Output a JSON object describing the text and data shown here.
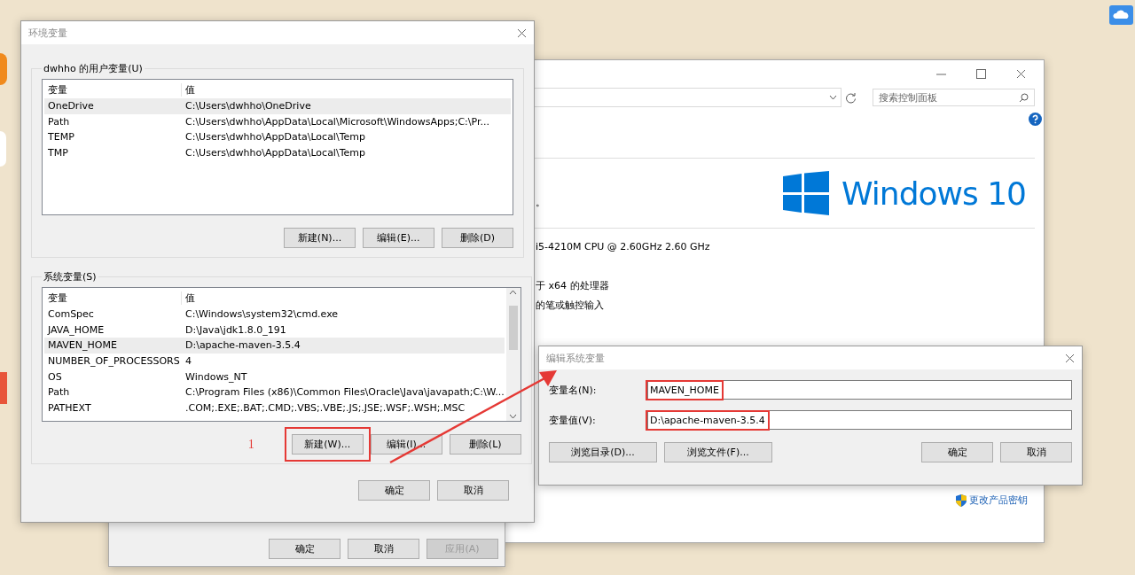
{
  "control_panel": {
    "search": {
      "placeholder": "搜索控制面板"
    },
    "texts": [
      "。",
      "i5-4210M CPU @ 2.60GHz   2.60 GHz",
      "于 x64 的处理器",
      "的笔或触控输入"
    ],
    "logo_text": "Windows 10",
    "link": "更改产品密钥"
  },
  "system_properties": {
    "buttons": [
      {
        "label": "确定",
        "disabled": false
      },
      {
        "label": "取消",
        "disabled": false
      },
      {
        "label": "应用(A)",
        "disabled": true
      }
    ]
  },
  "env_dialog": {
    "title": "环境变量",
    "groups": [
      {
        "label": "dwhho 的用户变量(U)",
        "columns": [
          "变量",
          "值"
        ],
        "scrollbar": false,
        "rows": [
          {
            "name": "OneDrive",
            "value": "C:\\Users\\dwhho\\OneDrive",
            "selected": true
          },
          {
            "name": "Path",
            "value": "C:\\Users\\dwhho\\AppData\\Local\\Microsoft\\WindowsApps;C:\\Pr...",
            "selected": false
          },
          {
            "name": "TEMP",
            "value": "C:\\Users\\dwhho\\AppData\\Local\\Temp",
            "selected": false
          },
          {
            "name": "TMP",
            "value": "C:\\Users\\dwhho\\AppData\\Local\\Temp",
            "selected": false
          }
        ],
        "buttons": [
          {
            "label": "新建(N)...",
            "highlighted": false
          },
          {
            "label": "编辑(E)...",
            "highlighted": false
          },
          {
            "label": "删除(D)",
            "highlighted": false
          }
        ]
      },
      {
        "label": "系统变量(S)",
        "columns": [
          "变量",
          "值"
        ],
        "scrollbar": true,
        "step_label": "1",
        "rows": [
          {
            "name": "ComSpec",
            "value": "C:\\Windows\\system32\\cmd.exe",
            "selected": false
          },
          {
            "name": "JAVA_HOME",
            "value": "D:\\Java\\jdk1.8.0_191",
            "selected": false
          },
          {
            "name": "MAVEN_HOME",
            "value": "D:\\apache-maven-3.5.4",
            "selected": true
          },
          {
            "name": "NUMBER_OF_PROCESSORS",
            "value": "4",
            "selected": false
          },
          {
            "name": "OS",
            "value": "Windows_NT",
            "selected": false
          },
          {
            "name": "Path",
            "value": "C:\\Program Files (x86)\\Common Files\\Oracle\\Java\\javapath;C:\\W...",
            "selected": false
          },
          {
            "name": "PATHEXT",
            "value": ".COM;.EXE;.BAT;.CMD;.VBS;.VBE;.JS;.JSE;.WSF;.WSH;.MSC",
            "selected": false
          }
        ],
        "buttons": [
          {
            "label": "新建(W)...",
            "highlighted": true
          },
          {
            "label": "编辑(I)...",
            "highlighted": false
          },
          {
            "label": "删除(L)",
            "highlighted": false
          }
        ]
      }
    ],
    "buttons": [
      "确定",
      "取消"
    ]
  },
  "edit_dialog": {
    "title": "编辑系统变量",
    "fields": [
      {
        "label": "变量名(N):",
        "value": "MAVEN_HOME",
        "highlighted": true
      },
      {
        "label": "变量值(V):",
        "value": "D:\\apache-maven-3.5.4",
        "highlighted": true
      }
    ],
    "left_buttons": [
      "浏览目录(D)...",
      "浏览文件(F)..."
    ],
    "right_buttons": [
      "确定",
      "取消"
    ]
  }
}
